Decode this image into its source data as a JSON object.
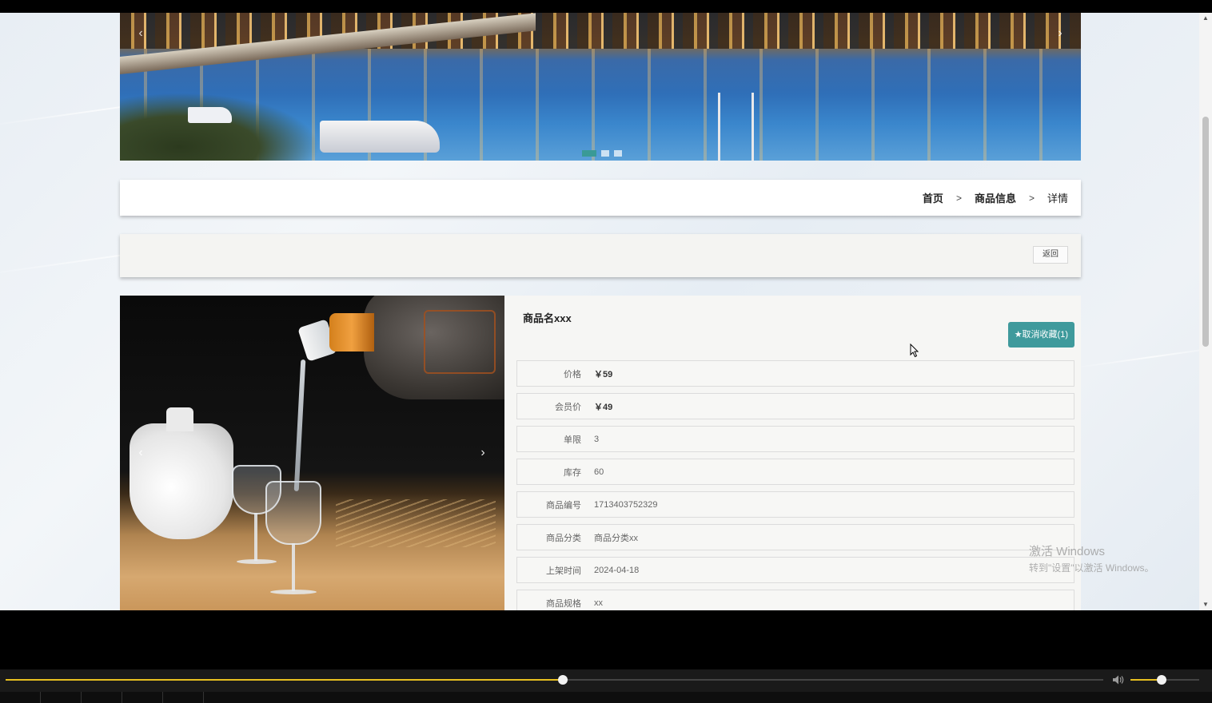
{
  "banner": {
    "prev_glyph": "‹",
    "next_glyph": "›",
    "dots": 3,
    "active_dot": 0
  },
  "breadcrumb": {
    "home": "首页",
    "section": "商品信息",
    "current": "详情",
    "separator": ">"
  },
  "actions": {
    "back_label": "返回"
  },
  "product": {
    "name": "商品名xxx",
    "favorite_label": "★取消收藏(1)",
    "image_prev_glyph": "‹",
    "image_next_glyph": "›",
    "fields": [
      {
        "label": "价格",
        "value": "￥59"
      },
      {
        "label": "会员价",
        "value": "￥49"
      },
      {
        "label": "单限",
        "value": "3"
      },
      {
        "label": "库存",
        "value": "60"
      },
      {
        "label": "商品编号",
        "value": "1713403752329"
      },
      {
        "label": "商品分类",
        "value": "商品分类xx"
      },
      {
        "label": "上架时间",
        "value": "2024-04-18"
      },
      {
        "label": "商品规格",
        "value": "xx"
      }
    ]
  },
  "watermark": {
    "line1": "激活 Windows",
    "line2": "转到\"设置\"以激活 Windows。"
  },
  "player": {
    "progress": 0.508,
    "volume": 0.45,
    "volume_icon": "speaker-icon"
  },
  "colors": {
    "accent": "#3f9a9c",
    "seek": "#e8c020"
  }
}
